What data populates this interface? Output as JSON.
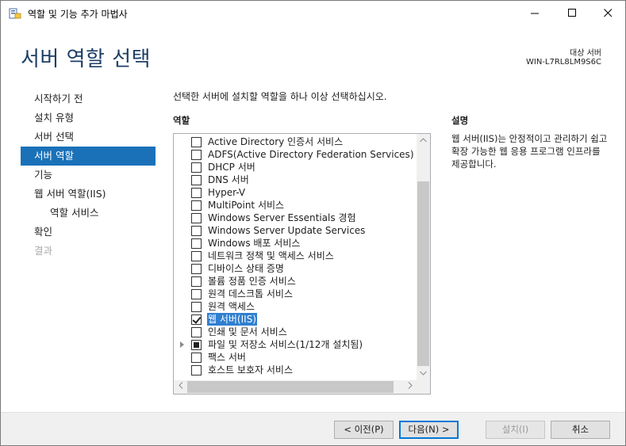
{
  "window": {
    "title": "역할 및 기능 추가 마법사",
    "minimize_glyph": "—",
    "maximize_glyph": "☐",
    "close_glyph": "✕",
    "icon": "server-manager-icon"
  },
  "header": {
    "title": "서버 역할 선택",
    "target_label": "대상 서버",
    "target_value": "WIN-L7RL8LM9S6C"
  },
  "nav": {
    "items": [
      {
        "label": "시작하기 전",
        "state": "normal"
      },
      {
        "label": "설치 유형",
        "state": "normal"
      },
      {
        "label": "서버 선택",
        "state": "normal"
      },
      {
        "label": "서버 역할",
        "state": "active"
      },
      {
        "label": "기능",
        "state": "normal"
      },
      {
        "label": "웹 서버 역할(IIS)",
        "state": "normal"
      },
      {
        "label": "역할 서비스",
        "state": "sub"
      },
      {
        "label": "확인",
        "state": "normal"
      },
      {
        "label": "결과",
        "state": "disabled"
      }
    ]
  },
  "main": {
    "instruction": "선택한 서버에 설치할 역할을 하나 이상 선택하십시오.",
    "roles_header": "역할",
    "description_header": "설명",
    "description": "웹 서버(IIS)는 안정적이고 관리하기 쉽고 확장 가능한 웹 응용 프로그램 인프라를 제공합니다.",
    "roles": [
      {
        "label": "Active Directory 인증서 서비스",
        "state": "unchecked"
      },
      {
        "label": "ADFS(Active Directory Federation Services)",
        "state": "unchecked"
      },
      {
        "label": "DHCP 서버",
        "state": "unchecked"
      },
      {
        "label": "DNS 서버",
        "state": "unchecked"
      },
      {
        "label": "Hyper-V",
        "state": "unchecked"
      },
      {
        "label": "MultiPoint 서비스",
        "state": "unchecked"
      },
      {
        "label": "Windows Server Essentials 경험",
        "state": "unchecked"
      },
      {
        "label": "Windows Server Update Services",
        "state": "unchecked"
      },
      {
        "label": "Windows 배포 서비스",
        "state": "unchecked"
      },
      {
        "label": "네트워크 정책 및 액세스 서비스",
        "state": "unchecked"
      },
      {
        "label": "디바이스 상태 증명",
        "state": "unchecked"
      },
      {
        "label": "볼륨 정품 인증 서비스",
        "state": "unchecked"
      },
      {
        "label": "원격 데스크톱 서비스",
        "state": "unchecked"
      },
      {
        "label": "원격 액세스",
        "state": "unchecked"
      },
      {
        "label": "웹 서버(IIS)",
        "state": "checked",
        "selected": true
      },
      {
        "label": "인쇄 및 문서 서비스",
        "state": "unchecked"
      },
      {
        "label": "파일 및 저장소 서비스(1/12개 설치됨)",
        "state": "partial",
        "expandable": true
      },
      {
        "label": "팩스 서버",
        "state": "unchecked"
      },
      {
        "label": "호스트 보호자 서비스",
        "state": "unchecked"
      }
    ]
  },
  "footer": {
    "prev_label": "< 이전(P)",
    "next_label": "다음(N) >",
    "install_label": "설치(I)",
    "cancel_label": "취소"
  },
  "colors": {
    "accent": "#1a71b8",
    "selection": "#2f7fd0",
    "title_text": "#1e3f66"
  }
}
